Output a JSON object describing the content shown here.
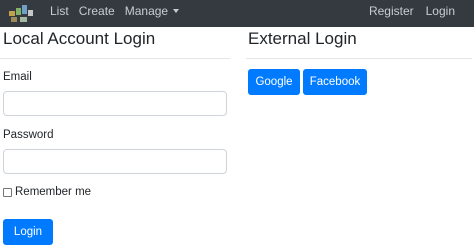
{
  "navbar": {
    "brand_icon": "app-logo-icon",
    "links": [
      "List",
      "Create",
      "Manage"
    ],
    "right_links": [
      "Register",
      "Login"
    ]
  },
  "local_login": {
    "heading": "Local Account Login",
    "email_label": "Email",
    "email_value": "",
    "password_label": "Password",
    "password_value": "",
    "remember_label": "Remember me",
    "remember_checked": false,
    "submit_label": "Login"
  },
  "external_login": {
    "heading": "External Login",
    "providers": [
      "Google",
      "Facebook"
    ]
  },
  "colors": {
    "navbar_bg": "#343a40",
    "primary": "#007bff"
  }
}
